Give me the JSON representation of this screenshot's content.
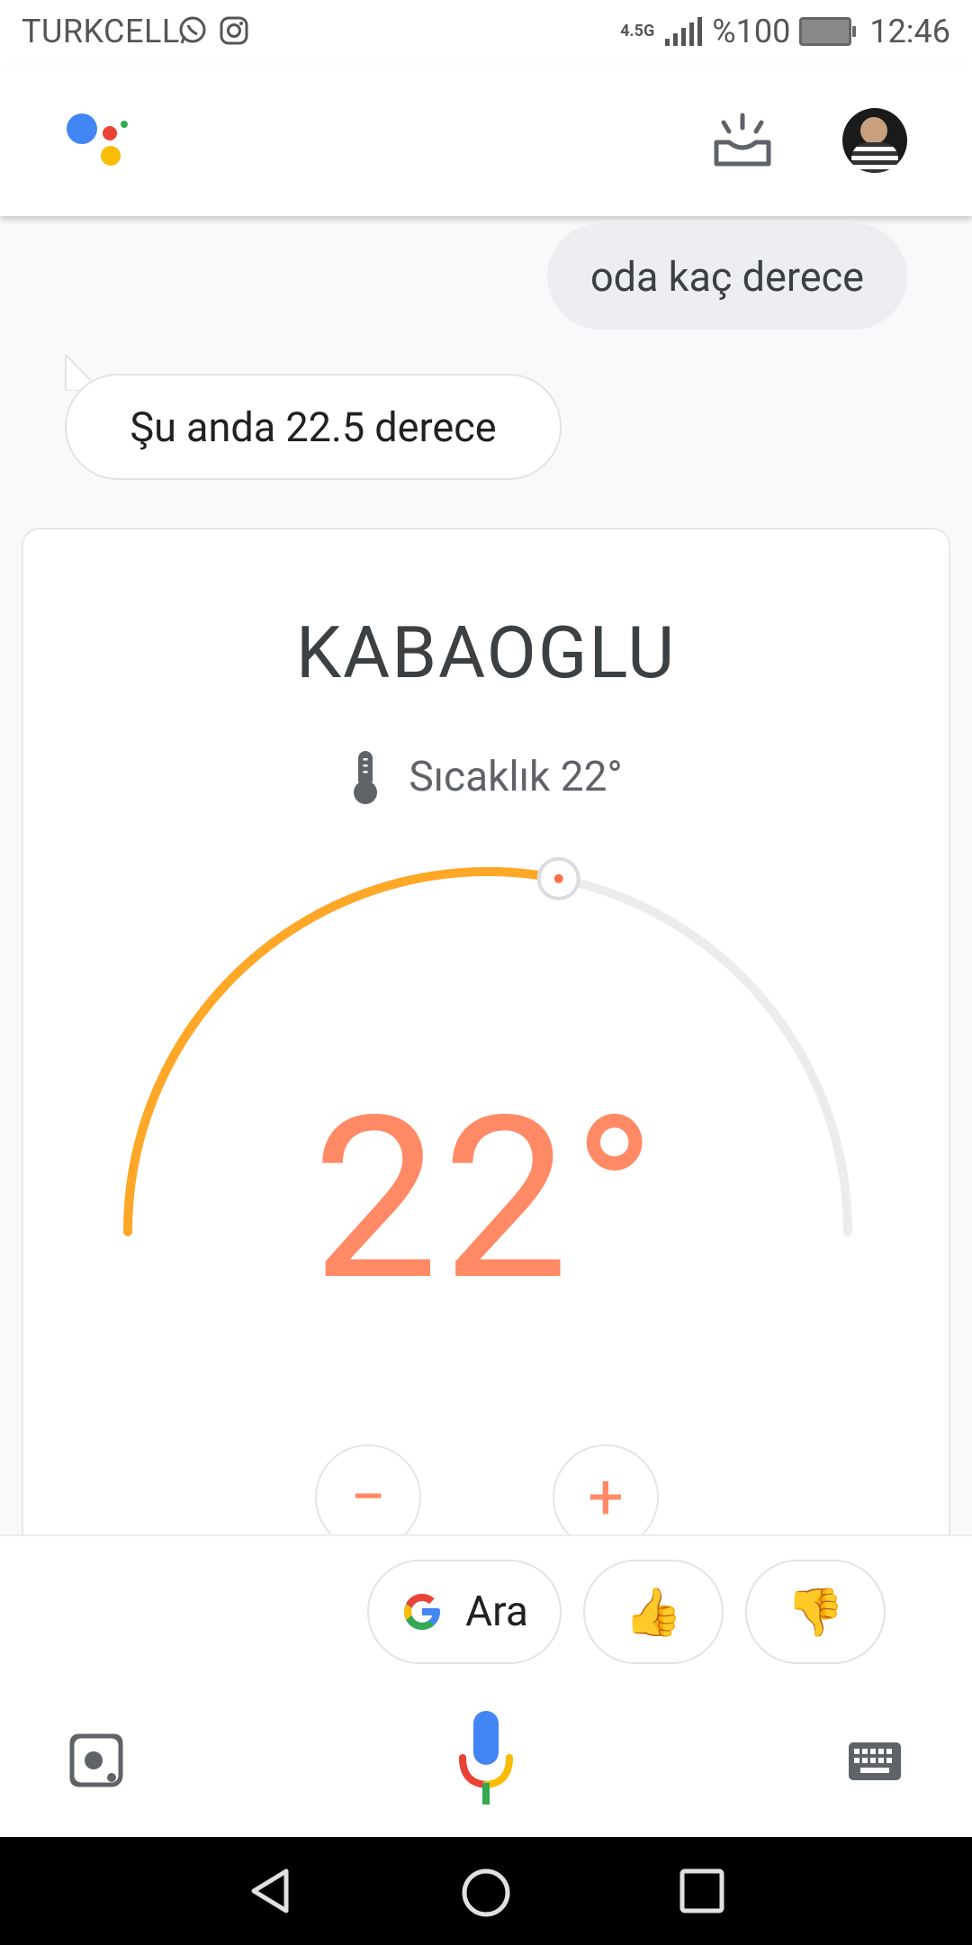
{
  "status_bar": {
    "carrier": "TURKCELL",
    "network": "4.5G",
    "battery": "%100",
    "time": "12:46"
  },
  "conversation": {
    "user_query": "oda kaç derece",
    "assistant_reply": "Şu anda 22.5 derece"
  },
  "thermostat": {
    "device_name": "KABAOGLU",
    "temperature_label": "Sıcaklık 22°",
    "setpoint": "22°",
    "setpoint_value": 22,
    "minus_label": "−",
    "plus_label": "+",
    "accent_color": "#ff8a65",
    "arc_color": "#ffa726"
  },
  "suggestions": {
    "search_label": "Ara"
  },
  "icons": {
    "thumb_up": "👍",
    "thumb_down": "👎"
  }
}
